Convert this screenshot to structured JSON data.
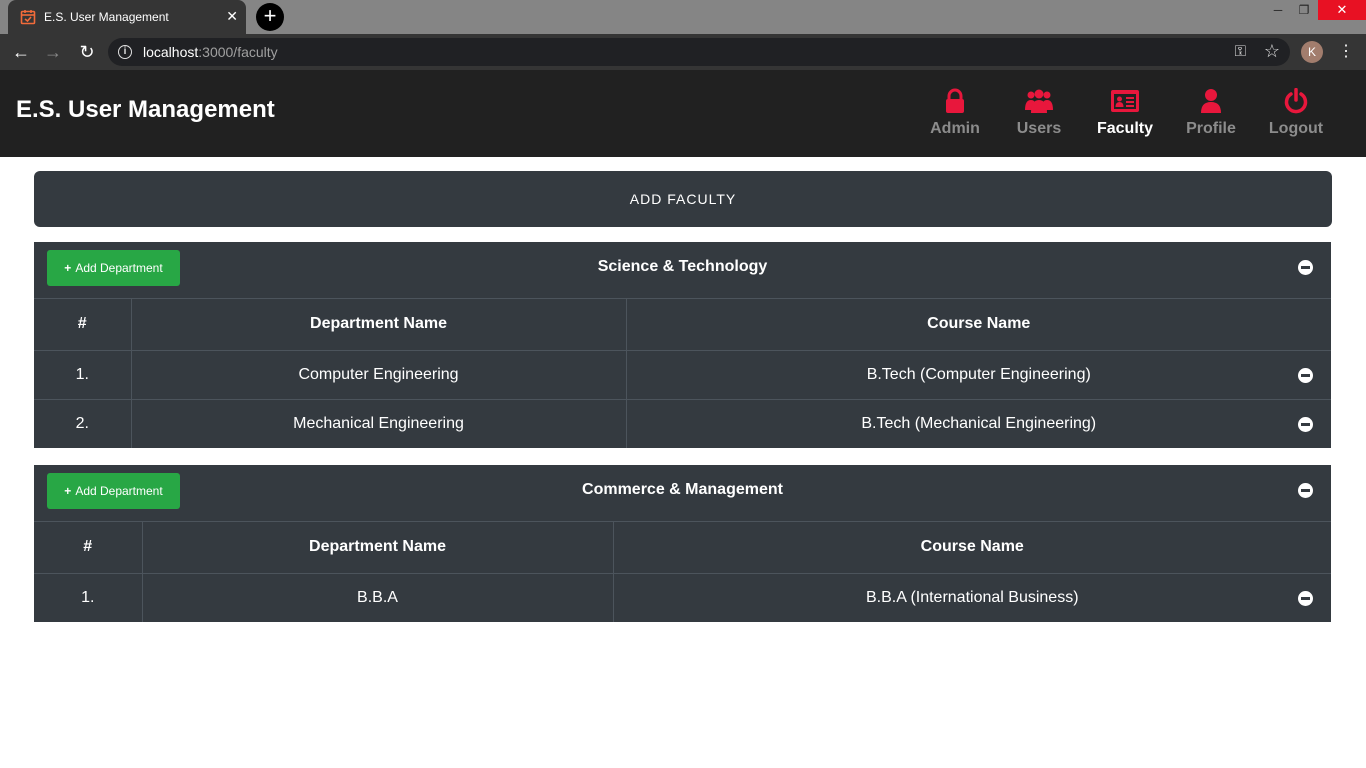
{
  "browser": {
    "tab_title": "E.S. User Management",
    "tab_close": "✕",
    "new_tab": "+",
    "url_host": "localhost",
    "url_rest": ":3000/faculty",
    "profile_initial": "K"
  },
  "app": {
    "brand": "E.S. User Management",
    "accent_color": "#e8173c",
    "nav": [
      {
        "label": "Admin",
        "icon": "lock-icon",
        "active": false
      },
      {
        "label": "Users",
        "icon": "users-icon",
        "active": false
      },
      {
        "label": "Faculty",
        "icon": "id-card-icon",
        "active": true
      },
      {
        "label": "Profile",
        "icon": "user-icon",
        "active": false
      },
      {
        "label": "Logout",
        "icon": "power-icon",
        "active": false
      }
    ]
  },
  "main": {
    "add_faculty_label": "ADD FACULTY",
    "faculties": [
      {
        "name": "Science & Technology",
        "add_department_label": "Add Department",
        "columns": [
          "#",
          "Department Name",
          "Course Name"
        ],
        "rows": [
          {
            "index": "1.",
            "department": "Computer Engineering",
            "course": "B.Tech (Computer Engineering)"
          },
          {
            "index": "2.",
            "department": "Mechanical Engineering",
            "course": "B.Tech (Mechanical Engineering)"
          }
        ]
      },
      {
        "name": "Commerce & Management",
        "add_department_label": "Add Department",
        "columns": [
          "#",
          "Department Name",
          "Course Name"
        ],
        "rows": [
          {
            "index": "1.",
            "department": "B.B.A",
            "course": "B.B.A (International Business)"
          }
        ]
      }
    ]
  }
}
